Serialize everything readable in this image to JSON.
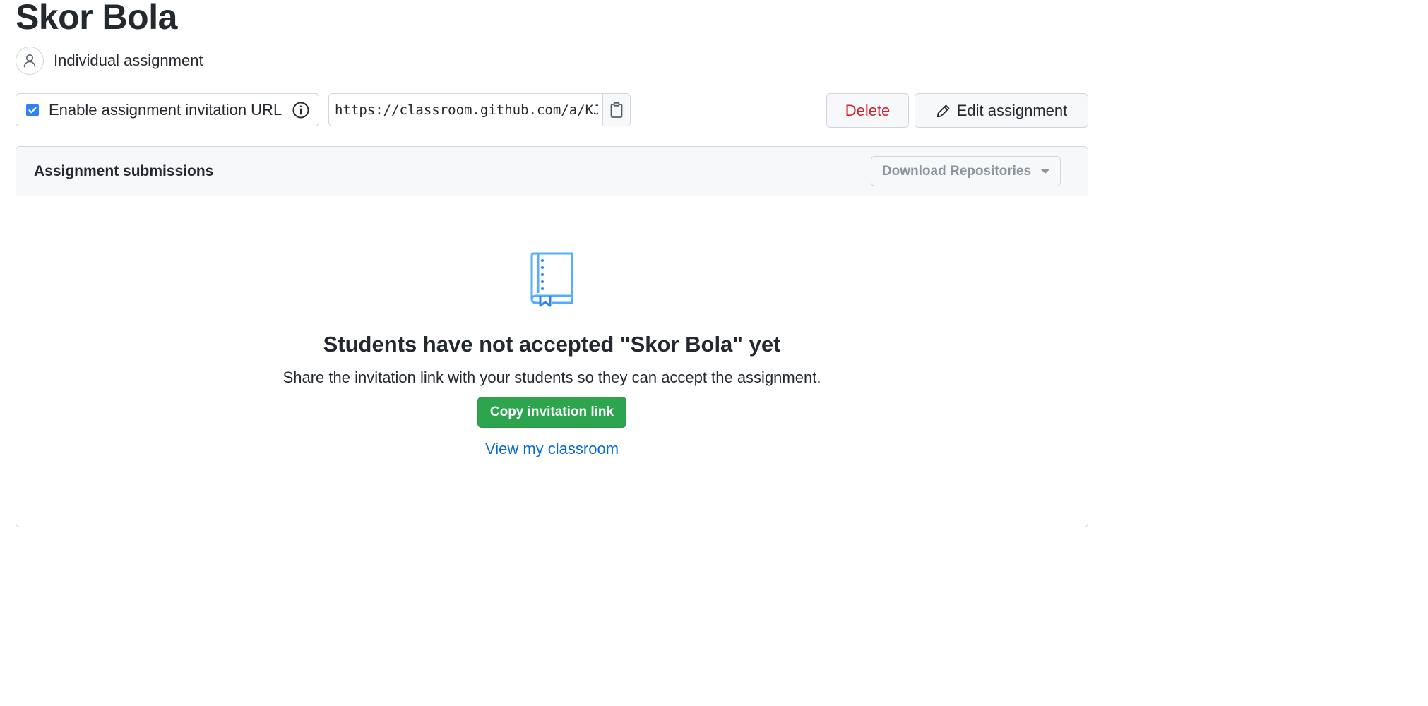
{
  "assignment": {
    "title": "Skor Bola",
    "type_label": "Individual assignment"
  },
  "invitation": {
    "enabled": true,
    "toggle_label": "Enable assignment invitation URL",
    "url": "https://classroom.github.com/a/KJX"
  },
  "actions": {
    "delete_label": "Delete",
    "edit_label": "Edit assignment"
  },
  "submissions": {
    "header": "Assignment submissions",
    "download_label": "Download Repositories",
    "empty_title": "Students have not accepted \"Skor Bola\" yet",
    "empty_text": "Share the invitation link with your students so they can accept the assignment.",
    "copy_link_label": "Copy invitation link",
    "view_classroom_label": "View my classroom"
  },
  "colors": {
    "checkbox": "#2f81f7",
    "danger": "#cf222e",
    "primary": "#2da44e",
    "link": "#0969da",
    "icon_blue": "#54aeff"
  },
  "icons": [
    "person-icon",
    "check-icon",
    "info-icon",
    "clipboard-icon",
    "pencil-icon",
    "caret-down-icon",
    "book-bookmark-icon"
  ]
}
